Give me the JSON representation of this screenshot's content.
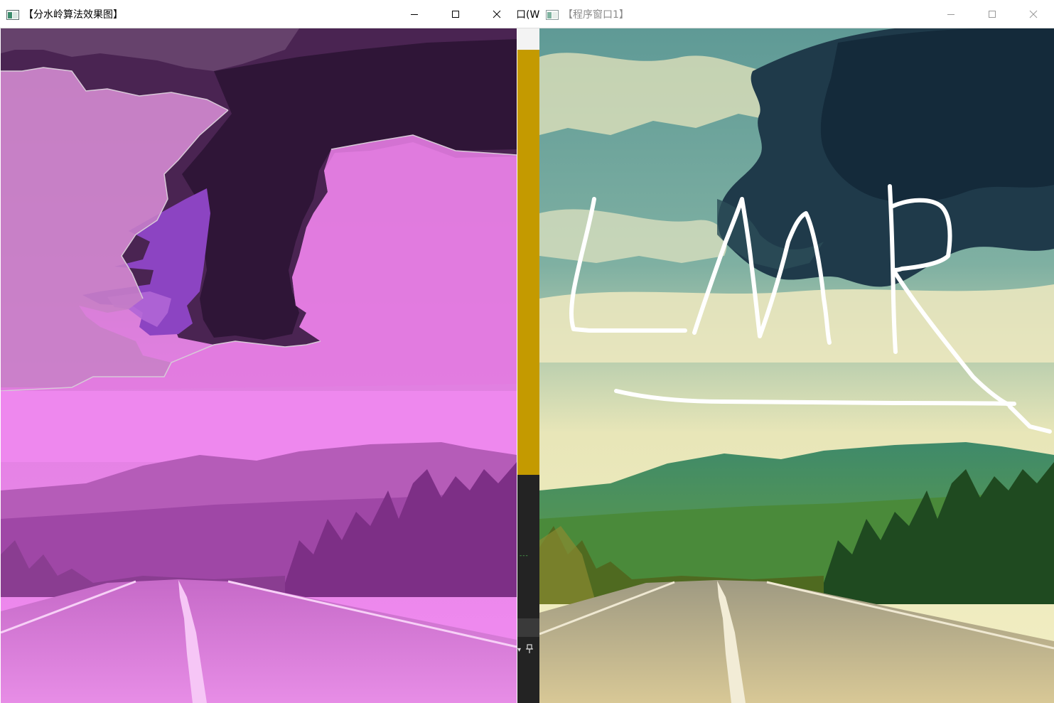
{
  "windows": {
    "left": {
      "title": "【分水岭算法效果图】",
      "controls": [
        "minimize-icon",
        "maximize-icon",
        "close-icon"
      ]
    },
    "right": {
      "title": "【程序窗口1】",
      "controls": [
        "minimize-icon",
        "maximize-icon",
        "close-icon"
      ],
      "drawing_text": "LMR"
    }
  },
  "background_app": {
    "partial_tab_text": "口(W"
  },
  "colors": {
    "magenta_light": "#ee7fee",
    "magenta_mid": "#b04ab8",
    "purple_dark": "#3b1a43",
    "violet": "#8b3fc0",
    "strip_gold": "#c49a00",
    "sky_teal": "#4f9a98",
    "grass_green": "#3f8a5f",
    "road_tan": "#c8b88a"
  }
}
